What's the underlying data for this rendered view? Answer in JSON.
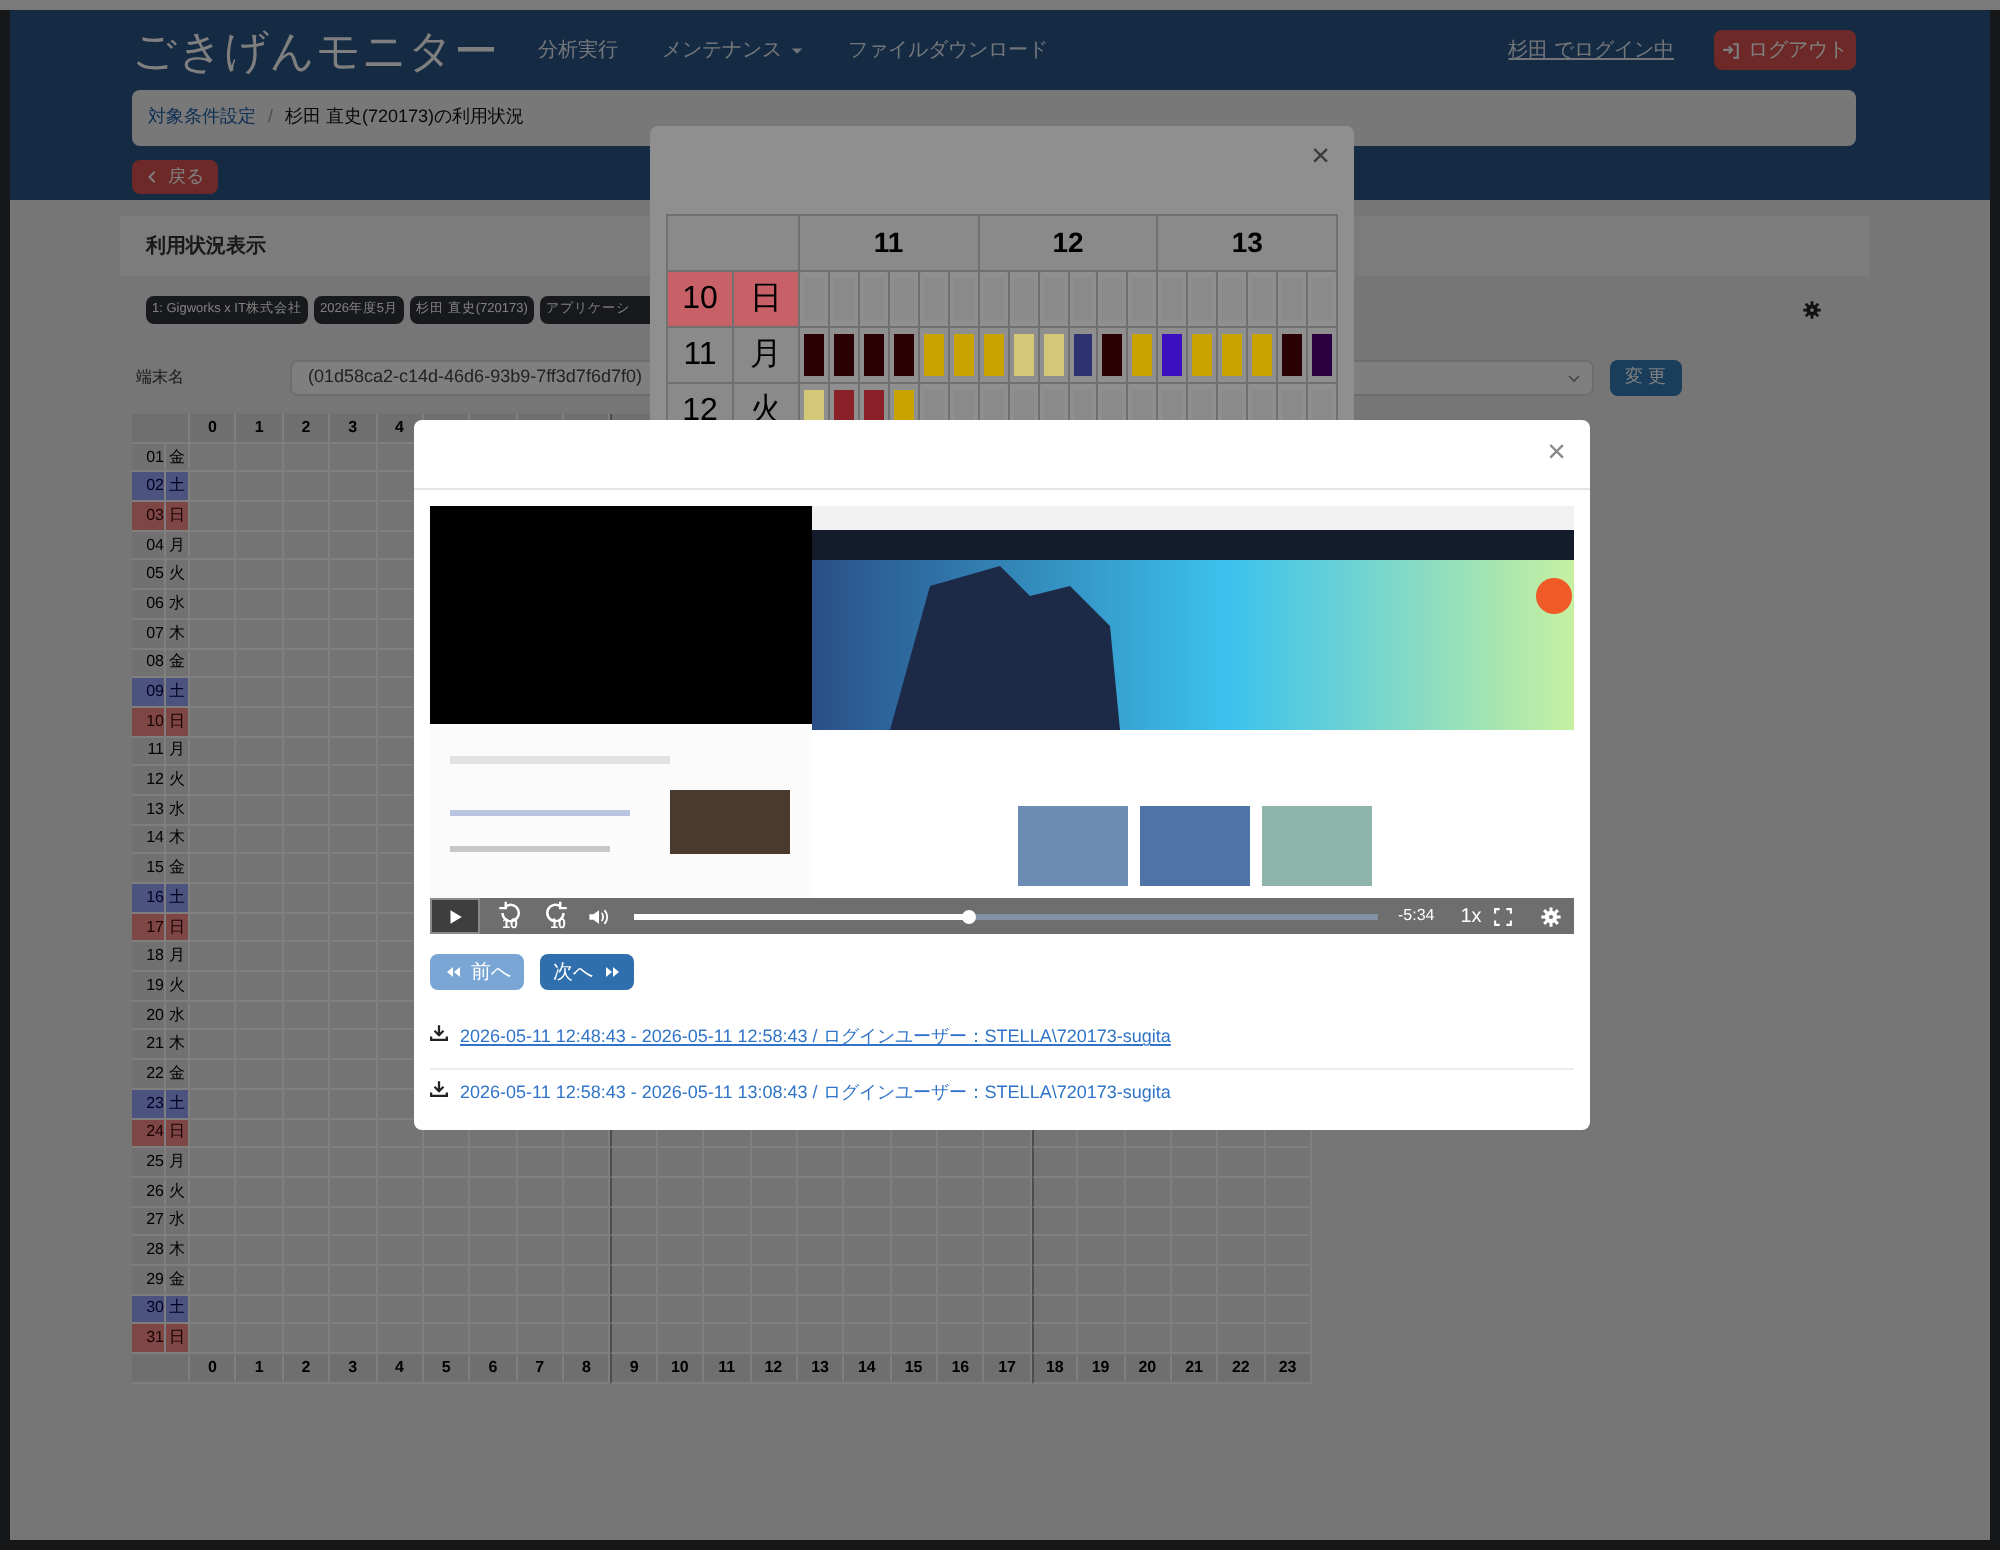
{
  "header": {
    "title": "ごきげんモニター",
    "nav": [
      {
        "label": "分析実行",
        "dropdown": false
      },
      {
        "label": "メンテナンス",
        "dropdown": true
      },
      {
        "label": "ファイルダウンロード",
        "dropdown": false
      }
    ],
    "login_status": "杉田 でログイン中",
    "logout_button": "ログアウト"
  },
  "breadcrumb": {
    "separator": "/",
    "items": [
      {
        "label": "対象条件設定",
        "link": true
      },
      {
        "label": "杉田 直史(720173)の利用状況",
        "link": false
      }
    ]
  },
  "back_button": "戻る",
  "panel": {
    "title": "利用状況表示",
    "tags": [
      "1: Gigworks x IT株式会社",
      "2026年度5月",
      "杉田 直史(720173)",
      "アプリケーシ"
    ],
    "terminal": {
      "label": "端末名",
      "value": "(01d58ca2-c14d-46d6-93b9-7ff3d7f6d7f0)"
    },
    "change_button": "変 更",
    "calendar": {
      "top_hours": [
        "0",
        "1",
        "2",
        "3",
        "4"
      ],
      "bottom_hours": [
        "0",
        "1",
        "2",
        "3",
        "4",
        "5",
        "6",
        "7",
        "8",
        "9",
        "10",
        "11",
        "12",
        "13",
        "14",
        "15",
        "16",
        "17",
        "18",
        "19",
        "20",
        "21",
        "22",
        "23"
      ],
      "days": [
        {
          "day": "01",
          "weekday": "金",
          "kind": "weekday"
        },
        {
          "day": "02",
          "weekday": "土",
          "kind": "saturday"
        },
        {
          "day": "03",
          "weekday": "日",
          "kind": "sunday"
        },
        {
          "day": "04",
          "weekday": "月",
          "kind": "weekday"
        },
        {
          "day": "05",
          "weekday": "火",
          "kind": "weekday"
        },
        {
          "day": "06",
          "weekday": "水",
          "kind": "weekday"
        },
        {
          "day": "07",
          "weekday": "木",
          "kind": "weekday"
        },
        {
          "day": "08",
          "weekday": "金",
          "kind": "weekday"
        },
        {
          "day": "09",
          "weekday": "土",
          "kind": "saturday"
        },
        {
          "day": "10",
          "weekday": "日",
          "kind": "sunday"
        },
        {
          "day": "11",
          "weekday": "月",
          "kind": "weekday"
        },
        {
          "day": "12",
          "weekday": "火",
          "kind": "weekday"
        },
        {
          "day": "13",
          "weekday": "水",
          "kind": "weekday"
        },
        {
          "day": "14",
          "weekday": "木",
          "kind": "weekday"
        },
        {
          "day": "15",
          "weekday": "金",
          "kind": "weekday"
        },
        {
          "day": "16",
          "weekday": "土",
          "kind": "saturday"
        },
        {
          "day": "17",
          "weekday": "日",
          "kind": "sunday"
        },
        {
          "day": "18",
          "weekday": "月",
          "kind": "weekday"
        },
        {
          "day": "19",
          "weekday": "火",
          "kind": "weekday"
        },
        {
          "day": "20",
          "weekday": "水",
          "kind": "weekday"
        },
        {
          "day": "21",
          "weekday": "木",
          "kind": "weekday"
        },
        {
          "day": "22",
          "weekday": "金",
          "kind": "weekday"
        },
        {
          "day": "23",
          "weekday": "土",
          "kind": "saturday"
        },
        {
          "day": "24",
          "weekday": "日",
          "kind": "sunday"
        },
        {
          "day": "25",
          "weekday": "月",
          "kind": "weekday"
        },
        {
          "day": "26",
          "weekday": "火",
          "kind": "weekday"
        },
        {
          "day": "27",
          "weekday": "水",
          "kind": "weekday"
        },
        {
          "day": "28",
          "weekday": "木",
          "kind": "weekday"
        },
        {
          "day": "29",
          "weekday": "金",
          "kind": "weekday"
        },
        {
          "day": "30",
          "weekday": "土",
          "kind": "saturday"
        },
        {
          "day": "31",
          "weekday": "日",
          "kind": "sunday"
        }
      ]
    }
  },
  "day_modal": {
    "close": "×",
    "hours": [
      "11",
      "12",
      "13"
    ],
    "rows": [
      {
        "day": "10",
        "weekday": "日",
        "kind": "sunday",
        "cells": [
          {
            "color": "#8a8a8a"
          },
          {
            "color": "#8a8a8a"
          },
          {
            "color": "#8a8a8a"
          },
          {
            "color": "#8a8a8a"
          },
          {
            "color": "#8a8a8a"
          },
          {
            "color": "#8a8a8a"
          },
          {
            "color": "#8a8a8a"
          },
          {
            "color": "#8a8a8a"
          },
          {
            "color": "#8a8a8a"
          },
          {
            "color": "#8a8a8a"
          },
          {
            "color": "#8a8a8a"
          },
          {
            "color": "#8a8a8a"
          },
          {
            "color": "#8a8a8a"
          },
          {
            "color": "#8a8a8a"
          },
          {
            "color": "#8a8a8a"
          },
          {
            "color": "#8a8a8a"
          },
          {
            "color": "#8a8a8a"
          },
          {
            "color": "#8a8a8a"
          }
        ]
      },
      {
        "day": "11",
        "weekday": "月",
        "kind": "weekday",
        "cells": [
          {
            "color": "#2a0005"
          },
          {
            "color": "#2a0005"
          },
          {
            "color": "#2a0005"
          },
          {
            "color": "#2a0005"
          },
          {
            "color": "#c9a400"
          },
          {
            "color": "#c9a400"
          },
          {
            "color": "#c9a400"
          },
          {
            "color": "#d4c878"
          },
          {
            "color": "#d4c878"
          },
          {
            "color": "#2e3270"
          },
          {
            "color": "#2a0005"
          },
          {
            "color": "#c9a400"
          },
          {
            "color": "#3a10c0"
          },
          {
            "color": "#c9a400"
          },
          {
            "color": "#c9a400"
          },
          {
            "color": "#c9a400"
          },
          {
            "color": "#2a0005"
          },
          {
            "color": "#2a0040"
          }
        ]
      },
      {
        "day": "12",
        "weekday": "火",
        "kind": "weekday",
        "cells": [
          {
            "color": "#d4c878"
          },
          {
            "color": "#8a2028"
          },
          {
            "color": "#8a2028"
          },
          {
            "color": "#c9a400"
          },
          {
            "color": "#8a8a8a"
          },
          {
            "color": "#8a8a8a"
          },
          {
            "color": "#8a8a8a"
          },
          {
            "color": "#8a8a8a"
          },
          {
            "color": "#8a8a8a"
          },
          {
            "color": "#8a8a8a"
          },
          {
            "color": "#8a8a8a"
          },
          {
            "color": "#8a8a8a"
          },
          {
            "color": "#8a8a8a"
          },
          {
            "color": "#8a8a8a"
          },
          {
            "color": "#8a8a8a"
          },
          {
            "color": "#8a8a8a"
          },
          {
            "color": "#8a8a8a"
          },
          {
            "color": "#8a8a8a"
          }
        ]
      }
    ]
  },
  "video_modal": {
    "close": "×",
    "player": {
      "playing": false,
      "skip_back": "10",
      "skip_forward": "10",
      "level": 0.45,
      "remaining": "-5:34",
      "speed": "1x"
    },
    "buttons": [
      {
        "label": "前へ",
        "kind": "prev",
        "disabled": true
      },
      {
        "label": "次へ",
        "kind": "next",
        "disabled": false
      }
    ],
    "recordings": [
      {
        "label": "2026-05-11 12:48:43 - 2026-05-11 12:58:43 / ログインユーザー：STELLA\\720173-sugita",
        "hovered": true
      },
      {
        "label": "2026-05-11 12:58:43 - 2026-05-11 13:08:43 / ログインユーザー：STELLA\\720173-sugita",
        "hovered": false
      }
    ]
  }
}
